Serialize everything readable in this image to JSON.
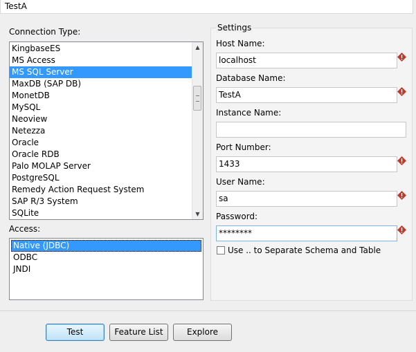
{
  "connection_name": "TestA",
  "connection_type": {
    "label": "Connection Type:",
    "items": [
      "KingbaseES",
      "MS Access",
      "MS SQL Server",
      "MaxDB (SAP DB)",
      "MonetDB",
      "MySQL",
      "Neoview",
      "Netezza",
      "Oracle",
      "Oracle RDB",
      "Palo MOLAP Server",
      "PostgreSQL",
      "Remedy Action Request System",
      "SAP R/3 System",
      "SQLite"
    ],
    "selected": "MS SQL Server"
  },
  "access": {
    "label": "Access:",
    "items": [
      "Native (JDBC)",
      "ODBC",
      "JNDI"
    ],
    "selected": "Native (JDBC)"
  },
  "settings": {
    "title": "Settings",
    "host_label": "Host Name:",
    "host_value": "localhost",
    "database_label": "Database Name:",
    "database_value": "TestA",
    "instance_label": "Instance Name:",
    "instance_value": "",
    "port_label": "Port Number:",
    "port_value": "1433",
    "user_label": "User Name:",
    "user_value": "sa",
    "password_label": "Password:",
    "password_value": "********",
    "separate_schema_label": "Use .. to Separate Schema and Table",
    "separate_schema_checked": false
  },
  "buttons": {
    "test": "Test",
    "feature_list": "Feature List",
    "explore": "Explore"
  },
  "icons": {
    "required_marker": "required-field-warning-icon"
  },
  "colors": {
    "selection": "#3399ff",
    "required_marker": "#c0392b"
  }
}
